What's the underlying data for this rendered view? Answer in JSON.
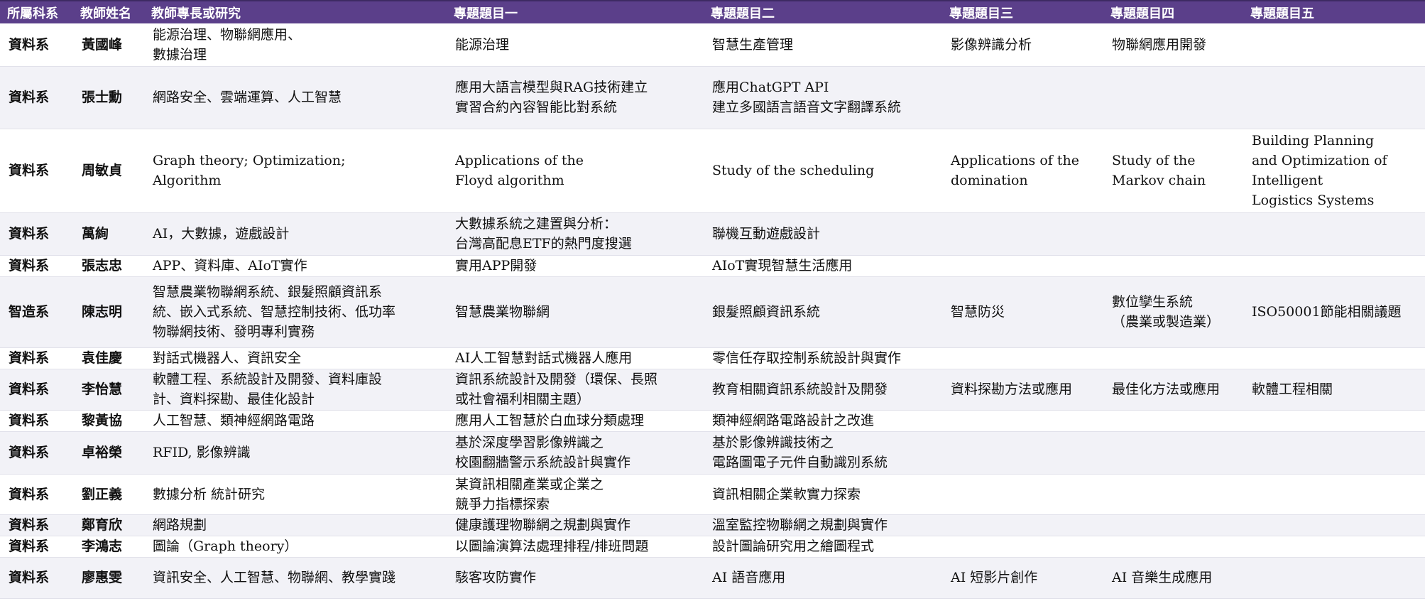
{
  "headers": [
    "所屬科系",
    "教師姓名",
    "教師專長或研究",
    "專題題目一",
    "專題題目二",
    "專題題目三",
    "專題題目四",
    "專題題目五"
  ],
  "rows": [
    [
      "資料系",
      "黃國峰",
      "能源治理、物聯網應用、\n數據治理",
      "能源治理",
      "智慧生產管理",
      "影像辨識分析",
      "物聯網應用開發",
      ""
    ],
    [
      "資料系",
      "張士勳",
      "網路安全、雲端運算、人工智慧",
      "應用大語言模型與RAG技術建立\n實習合約內容智能比對系統",
      "應用ChatGPT API\n建立多國語言語音文字翻譯系統",
      "",
      "",
      ""
    ],
    [
      "資料系",
      "周敏貞",
      "Graph theory; Optimization;\nAlgorithm",
      "Applications of the\nFloyd algorithm",
      "Study of the scheduling",
      "Applications of the\ndomination",
      "Study of the\n Markov chain",
      "Building Planning\nand Optimization of\n Intelligent\nLogistics Systems"
    ],
    [
      "資料系",
      "萬絢",
      "AI，大數據，遊戲設計",
      "大數據系統之建置與分析：\n台灣高配息ETF的熱門度搜選",
      "聯機互動遊戲設計",
      "",
      "",
      ""
    ],
    [
      "資料系",
      "張志忠",
      "APP、資料庫、AIoT實作",
      "實用APP開發",
      "AIoT實現智慧生活應用",
      "",
      "",
      ""
    ],
    [
      "智造系",
      "陳志明",
      "智慧農業物聯網系統、銀髮照顧資訊系\n統、嵌入式系統、智慧控制技術、低功率\n物聯網技術、發明專利實務",
      "智慧農業物聯網",
      "銀髮照顧資訊系統",
      "智慧防災",
      "數位孿生系統\n（農業或製造業）",
      "ISO50001節能相關議題"
    ],
    [
      "資料系",
      "袁佳慶",
      "對話式機器人、資訊安全",
      "AI人工智慧對話式機器人應用",
      "零信任存取控制系統設計與實作",
      "",
      "",
      ""
    ],
    [
      "資料系",
      "李怡慧",
      "軟體工程、系統設計及開發、資料庫設\n計、資料探勘、最佳化設計",
      "資訊系統設計及開發（環保、長照\n或社會福利相關主題）",
      "教育相關資訊系統設計及開發",
      "資料探勘方法或應用",
      "最佳化方法或應用",
      "軟體工程相關"
    ],
    [
      "資料系",
      "黎黃協",
      "人工智慧、類神經網路電路",
      "應用人工智慧於白血球分類處理",
      "類神經網路電路設計之改進",
      "",
      "",
      ""
    ],
    [
      "資料系",
      "卓裕榮",
      "RFID, 影像辨識",
      "基於深度學習影像辨識之\n校園翻牆警示系統設計與實作",
      "基於影像辨識技術之\n電路圖電子元件自動識別系統",
      "",
      "",
      ""
    ],
    [
      "資料系",
      "劉正義",
      "數據分析 統計研究",
      "某資訊相關產業或企業之\n競爭力指標探索",
      "資訊相關企業軟實力探索",
      "",
      "",
      ""
    ],
    [
      "資料系",
      "鄭育欣",
      "網路規劃",
      "健康護理物聯網之規劃與實作",
      "溫室監控物聯網之規劃與實作",
      "",
      "",
      ""
    ],
    [
      "資料系",
      "李鴻志",
      "圖論（Graph theory）",
      "以圖論演算法處理排程/排班問題",
      "設計圖論研究用之繪圖程式",
      "",
      "",
      ""
    ],
    [
      "資料系",
      "廖惠雯",
      "資訊安全、人工智慧、物聯網、教學實踐",
      "駭客攻防實作",
      "AI 語音應用",
      "AI 短影片創作",
      "AI 音樂生成應用",
      ""
    ]
  ]
}
